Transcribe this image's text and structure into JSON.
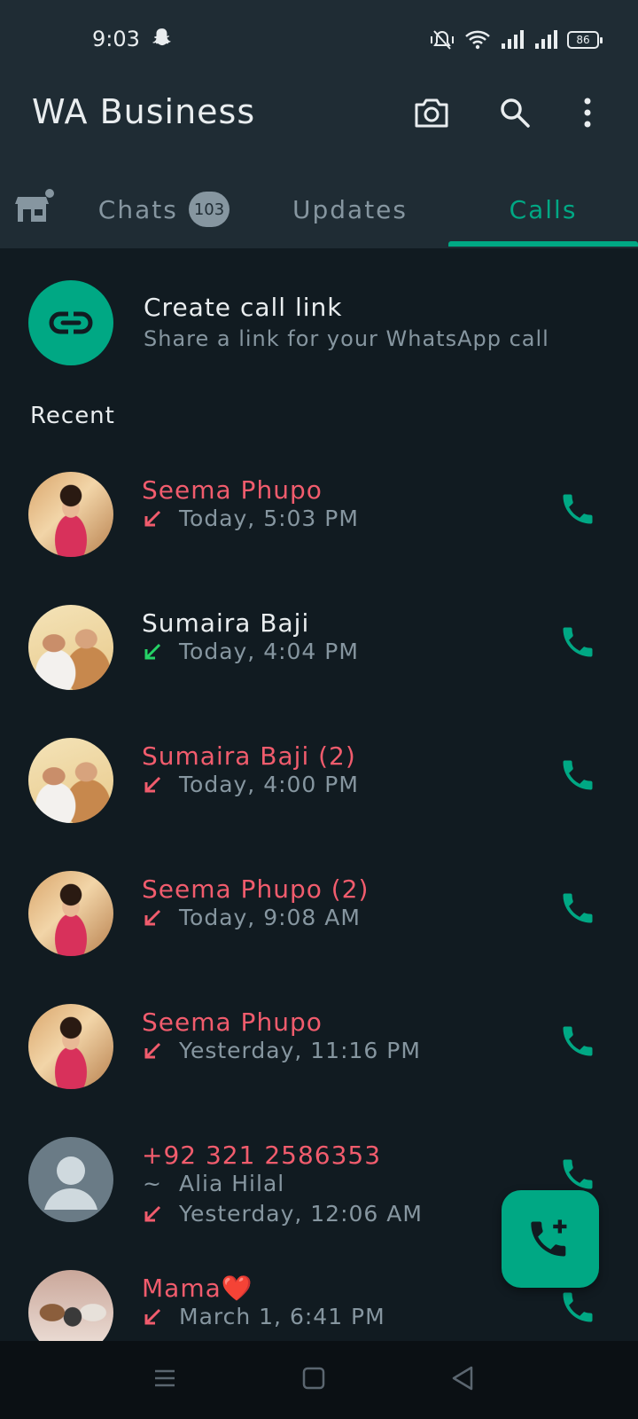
{
  "status_bar": {
    "time": "9:03",
    "battery": "86",
    "icons": [
      "snapchat-icon",
      "mute-icon",
      "wifi-icon",
      "signal-1-icon",
      "signal-2-icon",
      "battery-icon"
    ]
  },
  "app_bar": {
    "title": "WA Business",
    "actions": [
      "camera-icon",
      "search-icon",
      "more-icon"
    ]
  },
  "tabs": [
    {
      "label": "Chats",
      "badge": "103"
    },
    {
      "label": "Updates"
    },
    {
      "label": "Calls",
      "active": true
    }
  ],
  "create_link": {
    "title": "Create call link",
    "subtitle": "Share a link for your WhatsApp call"
  },
  "recent_label": "Recent",
  "calls": [
    {
      "name": "Seema Phupo",
      "time": "Today, 5:03 PM",
      "status": "missed",
      "avatar": "girl"
    },
    {
      "name": "Sumaira Baji",
      "time": "Today, 4:04 PM",
      "status": "incoming",
      "avatar": "couple"
    },
    {
      "name": "Sumaira Baji (2)",
      "time": "Today, 4:00 PM",
      "status": "missed",
      "avatar": "couple"
    },
    {
      "name": "Seema Phupo (2)",
      "time": "Today, 9:08 AM",
      "status": "missed",
      "avatar": "girl"
    },
    {
      "name": "Seema Phupo",
      "time": "Yesterday, 11:16 PM",
      "status": "missed",
      "avatar": "girl"
    },
    {
      "name": "+92 321 2586353",
      "alias": "Alia Hilal",
      "alias_prefix": "~",
      "time": "Yesterday, 12:06 AM",
      "status": "missed",
      "avatar": "default"
    },
    {
      "name": "Mama❤️",
      "time": "March 1, 6:41 PM",
      "status": "missed",
      "avatar": "family"
    }
  ],
  "colors": {
    "accent": "#00A884",
    "missed": "#F15C6D",
    "incoming": "#25D366",
    "background": "#111B21",
    "header": "#1F2C34"
  }
}
